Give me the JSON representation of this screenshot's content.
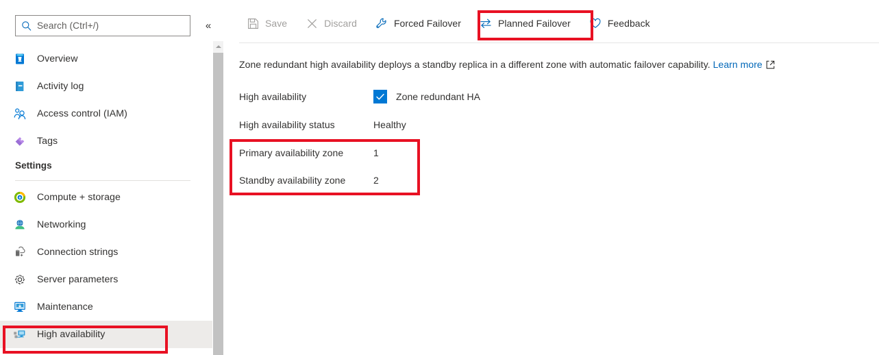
{
  "search": {
    "placeholder": "Search (Ctrl+/)",
    "value": "",
    "collapse_glyph": "«"
  },
  "sidebar": {
    "items": [
      {
        "label": "Overview",
        "icon": "database-icon",
        "selected": false
      },
      {
        "label": "Activity log",
        "icon": "activity-log-icon",
        "selected": false
      },
      {
        "label": "Access control (IAM)",
        "icon": "access-control-icon",
        "selected": false
      },
      {
        "label": "Tags",
        "icon": "tag-icon",
        "selected": false
      }
    ],
    "group_header": "Settings",
    "settings_items": [
      {
        "label": "Compute + storage",
        "icon": "compute-storage-icon",
        "selected": false
      },
      {
        "label": "Networking",
        "icon": "networking-icon",
        "selected": false
      },
      {
        "label": "Connection strings",
        "icon": "connection-strings-icon",
        "selected": false
      },
      {
        "label": "Server parameters",
        "icon": "server-parameters-icon",
        "selected": false
      },
      {
        "label": "Maintenance",
        "icon": "maintenance-icon",
        "selected": false
      },
      {
        "label": "High availability",
        "icon": "high-availability-icon",
        "selected": true
      }
    ]
  },
  "toolbar": {
    "save_label": "Save",
    "save_enabled": false,
    "discard_label": "Discard",
    "discard_enabled": false,
    "forced_failover_label": "Forced Failover",
    "planned_failover_label": "Planned Failover",
    "feedback_label": "Feedback"
  },
  "content": {
    "description": "Zone redundant high availability deploys a standby replica in a different zone with automatic failover capability.",
    "learn_more_label": "Learn more",
    "fields": [
      {
        "label": "High availability",
        "value": "Zone redundant HA",
        "type": "checkbox",
        "checked": true
      },
      {
        "label": "High availability status",
        "value": "Healthy",
        "type": "text"
      },
      {
        "label": "Primary availability zone",
        "value": "1",
        "type": "text"
      },
      {
        "label": "Standby availability zone",
        "value": "2",
        "type": "text"
      }
    ]
  },
  "annotations": {
    "highlight_color": "#e81123",
    "boxes": [
      {
        "name": "planned-failover-highlight"
      },
      {
        "name": "availability-zones-highlight"
      },
      {
        "name": "high-availability-nav-highlight"
      }
    ]
  },
  "colors": {
    "accent": "#0078d4",
    "link": "#0067b8",
    "selected_nav_bg": "#edebe9",
    "disabled_text": "#a19f9d"
  }
}
